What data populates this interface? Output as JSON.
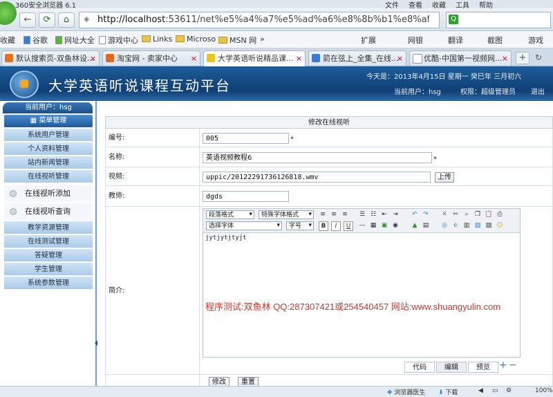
{
  "browser": {
    "title": "360安全浏览器 6.1",
    "menu": [
      "文件",
      "查看",
      "收藏",
      "工具",
      "帮助"
    ],
    "address_host": "http://localhost",
    "address_rest": ":53611/net%e5%a4%a7%e5%ad%a6%e8%8b%b1%e8%af%a",
    "bookmarks": [
      "收藏",
      "谷歌",
      "网址大全",
      "游戏中心",
      "Links",
      "Microso",
      "MSN 网",
      "»"
    ],
    "bookmarks_right": [
      "扩展",
      "网银",
      "翻译",
      "截图",
      "游戏"
    ],
    "tabs": [
      {
        "label": "默认搜索页-双鱼林设...",
        "color": "#e86f1c"
      },
      {
        "label": "淘宝网 - 卖家中心",
        "color": "#e8651c"
      },
      {
        "label": "大学英语听说精品课...",
        "color": "#f0c419"
      },
      {
        "label": "箭在弦上_全集_在线...",
        "color": "#3a7bd5"
      },
      {
        "label": "优酷-中国第一视频网...",
        "color": "#ffffff"
      }
    ]
  },
  "app": {
    "title": "大学英语听说课程互动平台",
    "date_text": "今天是：2013年4月15日 星期一 癸巳年 三月初六",
    "current_user": "当前用户：hsg",
    "permission": "权限：超级管理员",
    "logout": "退出",
    "left_user": "当前用户：hsg",
    "menu_title": "菜单管理",
    "menu": [
      "系统用户管理",
      "个人资料管理",
      "站内新闻管理",
      "在线视听管理"
    ],
    "submenu": [
      "在线视听添加",
      "在线视听查询"
    ],
    "menu2": [
      "教学资源管理",
      "在线测试管理",
      "答疑管理",
      "学生管理",
      "系统参数管理"
    ]
  },
  "form": {
    "title": "修改在线视听",
    "id_label": "编号:",
    "id_value": "005",
    "name_label": "名称:",
    "name_value": "英语视频教程6",
    "video_label": "视频:",
    "video_value": "uppic/20122291736126818.wmv",
    "upload": "上传",
    "teacher_label": "教师:",
    "teacher_value": "dgds",
    "intro_label": "简介:",
    "star": "*",
    "editor": {
      "paragraph": "段落格式",
      "font_format": "特殊字体格式",
      "font": "选择字体",
      "size": "字号",
      "content": "jytjytjtyjt",
      "watermark": "程序测试:双鱼林 QQ:287307421或254540457 网站:www.shuangyulin.com",
      "modes": [
        "代码",
        "编辑",
        "预览"
      ],
      "plus": "+",
      "minus": "−"
    },
    "submit": "修改",
    "reset": "重置"
  },
  "status": {
    "doctor": "浏览器医生",
    "download": "下载",
    "zoom": "100%"
  }
}
